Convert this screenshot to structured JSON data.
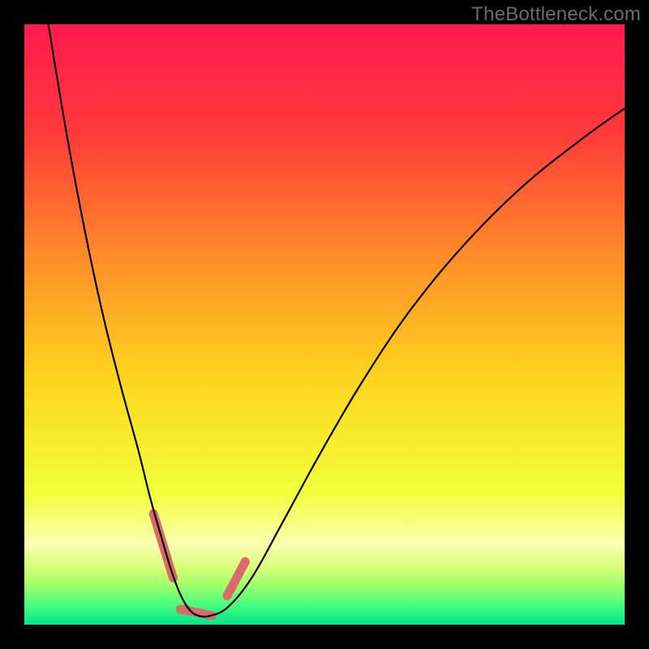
{
  "watermark": "TheBottleneck.com",
  "chart_data": {
    "type": "line",
    "title": "",
    "xlabel": "",
    "ylabel": "",
    "xlim": [
      0,
      100
    ],
    "ylim": [
      0,
      100
    ],
    "grid": false,
    "legend": false,
    "background": {
      "type": "vertical-gradient",
      "stops": [
        {
          "pos": 0.0,
          "color": "#ff1a4f"
        },
        {
          "pos": 0.18,
          "color": "#ff3a3a"
        },
        {
          "pos": 0.38,
          "color": "#ff8a2a"
        },
        {
          "pos": 0.58,
          "color": "#ffd21f"
        },
        {
          "pos": 0.78,
          "color": "#f2ff3a"
        },
        {
          "pos": 0.865,
          "color": "#fbffb0"
        },
        {
          "pos": 0.905,
          "color": "#d8ff7a"
        },
        {
          "pos": 0.935,
          "color": "#9fff6a"
        },
        {
          "pos": 0.965,
          "color": "#4fff7f"
        },
        {
          "pos": 1.0,
          "color": "#00e589"
        }
      ]
    },
    "series": [
      {
        "name": "bottleneck-curve",
        "color": "#000000",
        "x": [
          4,
          7,
          10,
          13,
          16,
          19,
          21,
          23,
          24.5,
          26,
          27.5,
          29,
          31,
          34,
          38,
          43,
          49,
          56,
          64,
          73,
          83,
          93,
          100
        ],
        "y": [
          100,
          82,
          66,
          52,
          40,
          29,
          21,
          14,
          9,
          5,
          2.5,
          1.5,
          1.5,
          3,
          8,
          17,
          28,
          40,
          52,
          63,
          73,
          81,
          86
        ]
      }
    ],
    "markers": {
      "name": "highlight-segments",
      "color": "#da6a6a",
      "segments": [
        {
          "x": [
            21.5,
            23.5
          ],
          "y": [
            18.5,
            12.0
          ]
        },
        {
          "x": [
            23.4,
            24.8
          ],
          "y": [
            12.3,
            7.8
          ]
        },
        {
          "x": [
            26.0,
            31.2
          ],
          "y": [
            2.6,
            1.5
          ]
        },
        {
          "x": [
            33.8,
            36.8
          ],
          "y": [
            4.8,
            10.5
          ]
        }
      ]
    },
    "optimum_x": 29,
    "optimum_y": 1.5
  }
}
